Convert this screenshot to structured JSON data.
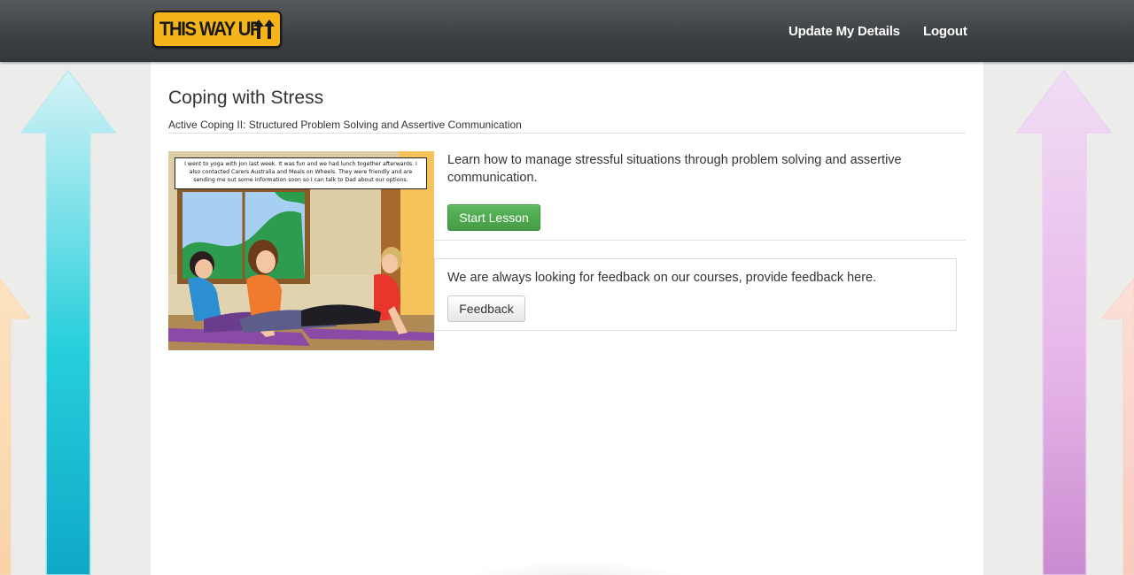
{
  "navbar": {
    "logo_text": "THIS WAY UP",
    "logo_icon": "double-up-arrow-icon",
    "links": [
      {
        "label": "Update My Details"
      },
      {
        "label": "Logout"
      }
    ]
  },
  "page": {
    "title": "Coping with Stress",
    "subtitle": "Active Coping II: Structured Problem Solving and Assertive Communication"
  },
  "lesson": {
    "image_caption": "I went to yoga with Jon last week. It was fun and we had lunch together afterwards. I also contacted Carers Australia and Meals on Wheels. They were friendly and are sending me out some information soon so I can talk to Dad about our options.",
    "description": "Learn how to manage stressful situations through problem solving and assertive communication.",
    "start_button": "Start Lesson"
  },
  "feedback": {
    "text": "We are always looking for feedback on our courses, provide feedback here.",
    "button": "Feedback"
  },
  "colors": {
    "navbar": "#3d4144",
    "logo": "#f5b51a",
    "start_button": "#5cb85c",
    "background": "#ecedeb"
  }
}
